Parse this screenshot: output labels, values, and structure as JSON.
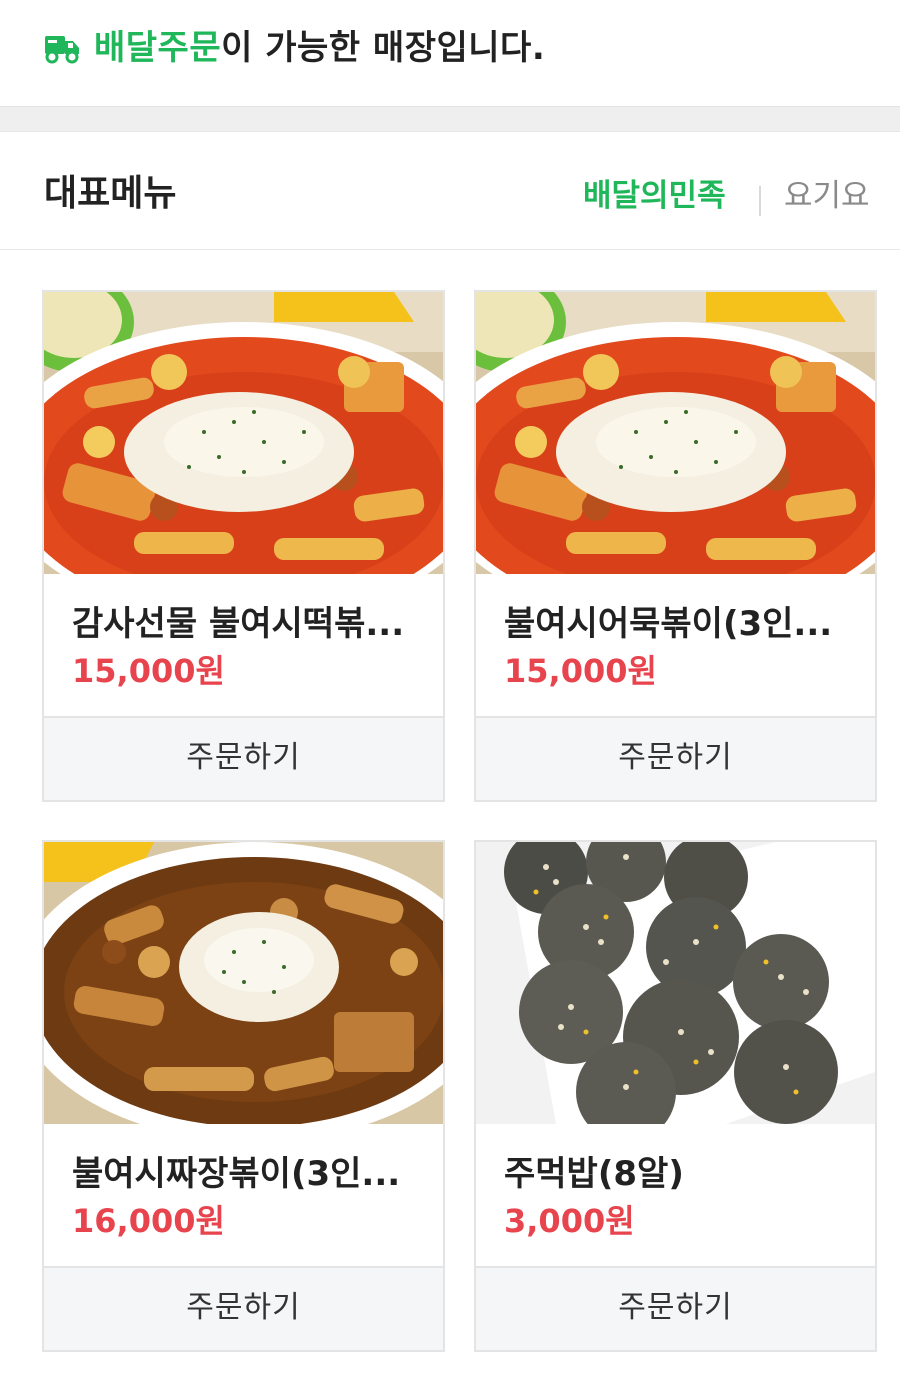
{
  "banner": {
    "icon": "delivery-truck-icon",
    "highlight": "배달주문",
    "rest": "이 가능한 매장입니다.",
    "highlight_color": "#1fb75a"
  },
  "section": {
    "title": "대표메뉴",
    "tabs": [
      {
        "label": "배달의민족",
        "active": true
      },
      {
        "label": "요기요",
        "active": false
      }
    ]
  },
  "menu": [
    {
      "name": "감사선물 불여시떡볶...",
      "price": "15,000원",
      "order_label": "주문하기",
      "image": "red-tteokbokki-photo"
    },
    {
      "name": "불여시어묵볶이(3인...",
      "price": "15,000원",
      "order_label": "주문하기",
      "image": "red-tteokbokki-photo"
    },
    {
      "name": "불여시짜장볶이(3인...",
      "price": "16,000원",
      "order_label": "주문하기",
      "image": "jjajang-tteokbokki-photo"
    },
    {
      "name": "주먹밥(8알)",
      "price": "3,000원",
      "order_label": "주문하기",
      "image": "rice-ball-photo"
    }
  ],
  "colors": {
    "accent_green": "#1fb75a",
    "price_red": "#e8444d"
  }
}
